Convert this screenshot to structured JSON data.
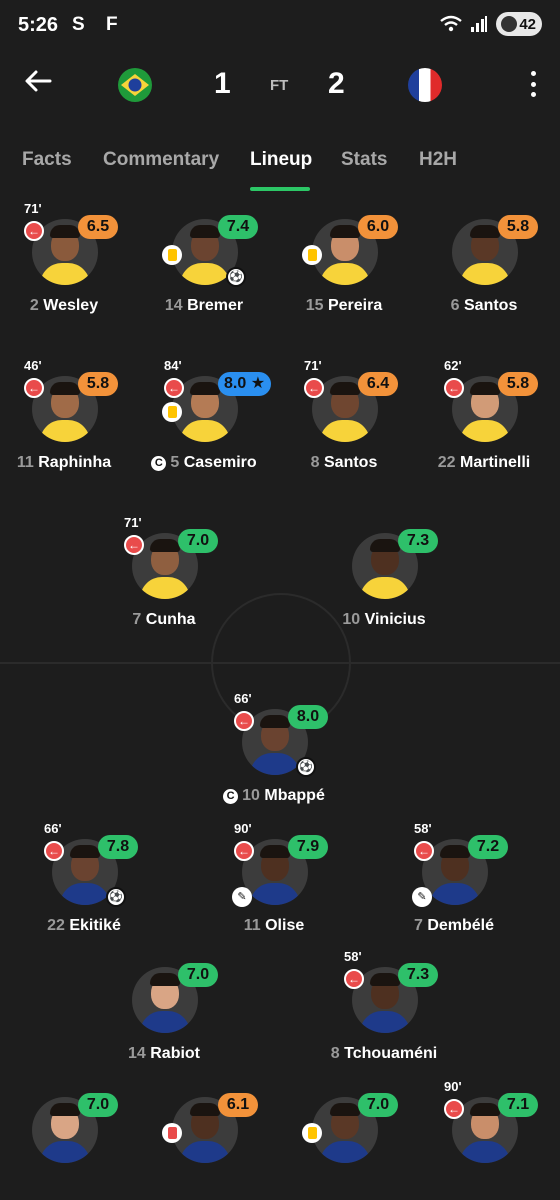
{
  "status_bar": {
    "time": "5:26",
    "icons": "S F",
    "battery": "42"
  },
  "match": {
    "home_score": "1",
    "away_score": "2",
    "status": "FT",
    "home_flag": "brazil-flag-icon",
    "away_flag": "france-flag-icon"
  },
  "tabs": [
    {
      "label": "Facts"
    },
    {
      "label": "Commentary"
    },
    {
      "label": "Lineup"
    },
    {
      "label": "Stats"
    },
    {
      "label": "H2H"
    }
  ],
  "active_tab": "Lineup",
  "colors": {
    "accent_green": "#2cc766",
    "rating_green": "#2ec06a",
    "rating_orange": "#f2923a",
    "rating_blue": "#2a8ff0",
    "sub_red": "#e94b4b"
  },
  "players": [
    {
      "number": "2",
      "name": "Wesley",
      "rating": "6.5",
      "rating_color": "orange",
      "minute": "71'",
      "sub": true,
      "card": "",
      "goal": false,
      "assist": false,
      "captain": false,
      "skin": "#8a5a3c",
      "shirt": "#f7d33a"
    },
    {
      "number": "14",
      "name": "Bremer",
      "rating": "7.4",
      "rating_color": "green",
      "minute": "",
      "sub": false,
      "card": "yellow",
      "goal": true,
      "assist": false,
      "captain": false,
      "skin": "#6b4430",
      "shirt": "#f7d33a"
    },
    {
      "number": "15",
      "name": "Pereira",
      "rating": "6.0",
      "rating_color": "orange",
      "minute": "",
      "sub": false,
      "card": "yellow",
      "goal": false,
      "assist": false,
      "captain": false,
      "skin": "#c98e6a",
      "shirt": "#f7d33a"
    },
    {
      "number": "6",
      "name": "Santos",
      "rating": "5.8",
      "rating_color": "orange",
      "minute": "",
      "sub": false,
      "card": "",
      "goal": false,
      "assist": false,
      "captain": false,
      "skin": "#5a3826",
      "shirt": "#f7d33a"
    },
    {
      "number": "11",
      "name": "Raphinha",
      "rating": "5.8",
      "rating_color": "orange",
      "minute": "46'",
      "sub": true,
      "card": "",
      "goal": false,
      "assist": false,
      "captain": false,
      "skin": "#a06b48",
      "shirt": "#f7d33a"
    },
    {
      "number": "5",
      "name": "Casemiro",
      "rating": "8.0 ★",
      "rating_color": "blue",
      "minute": "84'",
      "sub": true,
      "card": "yellow",
      "goal": false,
      "assist": false,
      "captain": true,
      "skin": "#b47b55",
      "shirt": "#f7d33a"
    },
    {
      "number": "8",
      "name": "Santos",
      "rating": "6.4",
      "rating_color": "orange",
      "minute": "71'",
      "sub": true,
      "card": "",
      "goal": false,
      "assist": false,
      "captain": false,
      "skin": "#6f4630",
      "shirt": "#f7d33a"
    },
    {
      "number": "22",
      "name": "Martinelli",
      "rating": "5.8",
      "rating_color": "orange",
      "minute": "62'",
      "sub": true,
      "card": "",
      "goal": false,
      "assist": false,
      "captain": false,
      "skin": "#d19b77",
      "shirt": "#f7d33a"
    },
    {
      "number": "7",
      "name": "Cunha",
      "rating": "7.0",
      "rating_color": "green",
      "minute": "71'",
      "sub": true,
      "card": "",
      "goal": false,
      "assist": false,
      "captain": false,
      "skin": "#8f5f40",
      "shirt": "#f7d33a"
    },
    {
      "number": "10",
      "name": "Vinicius",
      "rating": "7.3",
      "rating_color": "green",
      "minute": "",
      "sub": false,
      "card": "",
      "goal": false,
      "assist": false,
      "captain": false,
      "skin": "#4e3020",
      "shirt": "#f7d33a"
    },
    {
      "number": "10",
      "name": "Mbappé",
      "rating": "8.0",
      "rating_color": "green",
      "minute": "66'",
      "sub": true,
      "card": "",
      "goal": true,
      "assist": false,
      "captain": true,
      "skin": "#6a4330",
      "shirt": "#1e3a8a"
    },
    {
      "number": "22",
      "name": "Ekitiké",
      "rating": "7.8",
      "rating_color": "green",
      "minute": "66'",
      "sub": true,
      "card": "",
      "goal": true,
      "assist": false,
      "captain": false,
      "skin": "#6a4330",
      "shirt": "#1e3a8a"
    },
    {
      "number": "11",
      "name": "Olise",
      "rating": "7.9",
      "rating_color": "green",
      "minute": "90'",
      "sub": true,
      "card": "",
      "goal": false,
      "assist": true,
      "captain": false,
      "skin": "#4e3020",
      "shirt": "#1e3a8a"
    },
    {
      "number": "7",
      "name": "Dembélé",
      "rating": "7.2",
      "rating_color": "green",
      "minute": "58'",
      "sub": true,
      "card": "",
      "goal": false,
      "assist": true,
      "captain": false,
      "skin": "#4e3020",
      "shirt": "#1e3a8a"
    },
    {
      "number": "14",
      "name": "Rabiot",
      "rating": "7.0",
      "rating_color": "green",
      "minute": "",
      "sub": false,
      "card": "",
      "goal": false,
      "assist": false,
      "captain": false,
      "skin": "#d9a585",
      "shirt": "#1e3a8a"
    },
    {
      "number": "8",
      "name": "Tchouaméni",
      "rating": "7.3",
      "rating_color": "green",
      "minute": "58'",
      "sub": true,
      "card": "",
      "goal": false,
      "assist": false,
      "captain": false,
      "skin": "#4e3020",
      "shirt": "#1e3a8a"
    },
    {
      "number": "",
      "name": "",
      "rating": "7.0",
      "rating_color": "green",
      "minute": "",
      "sub": false,
      "card": "",
      "goal": false,
      "assist": false,
      "captain": false,
      "skin": "#d9a585",
      "shirt": "#1e3a8a"
    },
    {
      "number": "",
      "name": "",
      "rating": "6.1",
      "rating_color": "orange",
      "minute": "",
      "sub": false,
      "card": "red",
      "goal": false,
      "assist": false,
      "captain": false,
      "skin": "#4e3020",
      "shirt": "#1e3a8a"
    },
    {
      "number": "",
      "name": "",
      "rating": "7.0",
      "rating_color": "green",
      "minute": "",
      "sub": false,
      "card": "yellow",
      "goal": false,
      "assist": false,
      "captain": false,
      "skin": "#5a3826",
      "shirt": "#1e3a8a"
    },
    {
      "number": "",
      "name": "",
      "rating": "7.1",
      "rating_color": "green",
      "minute": "90'",
      "sub": true,
      "card": "",
      "goal": false,
      "assist": false,
      "captain": false,
      "skin": "#c98e6a",
      "shirt": "#1e3a8a"
    }
  ]
}
